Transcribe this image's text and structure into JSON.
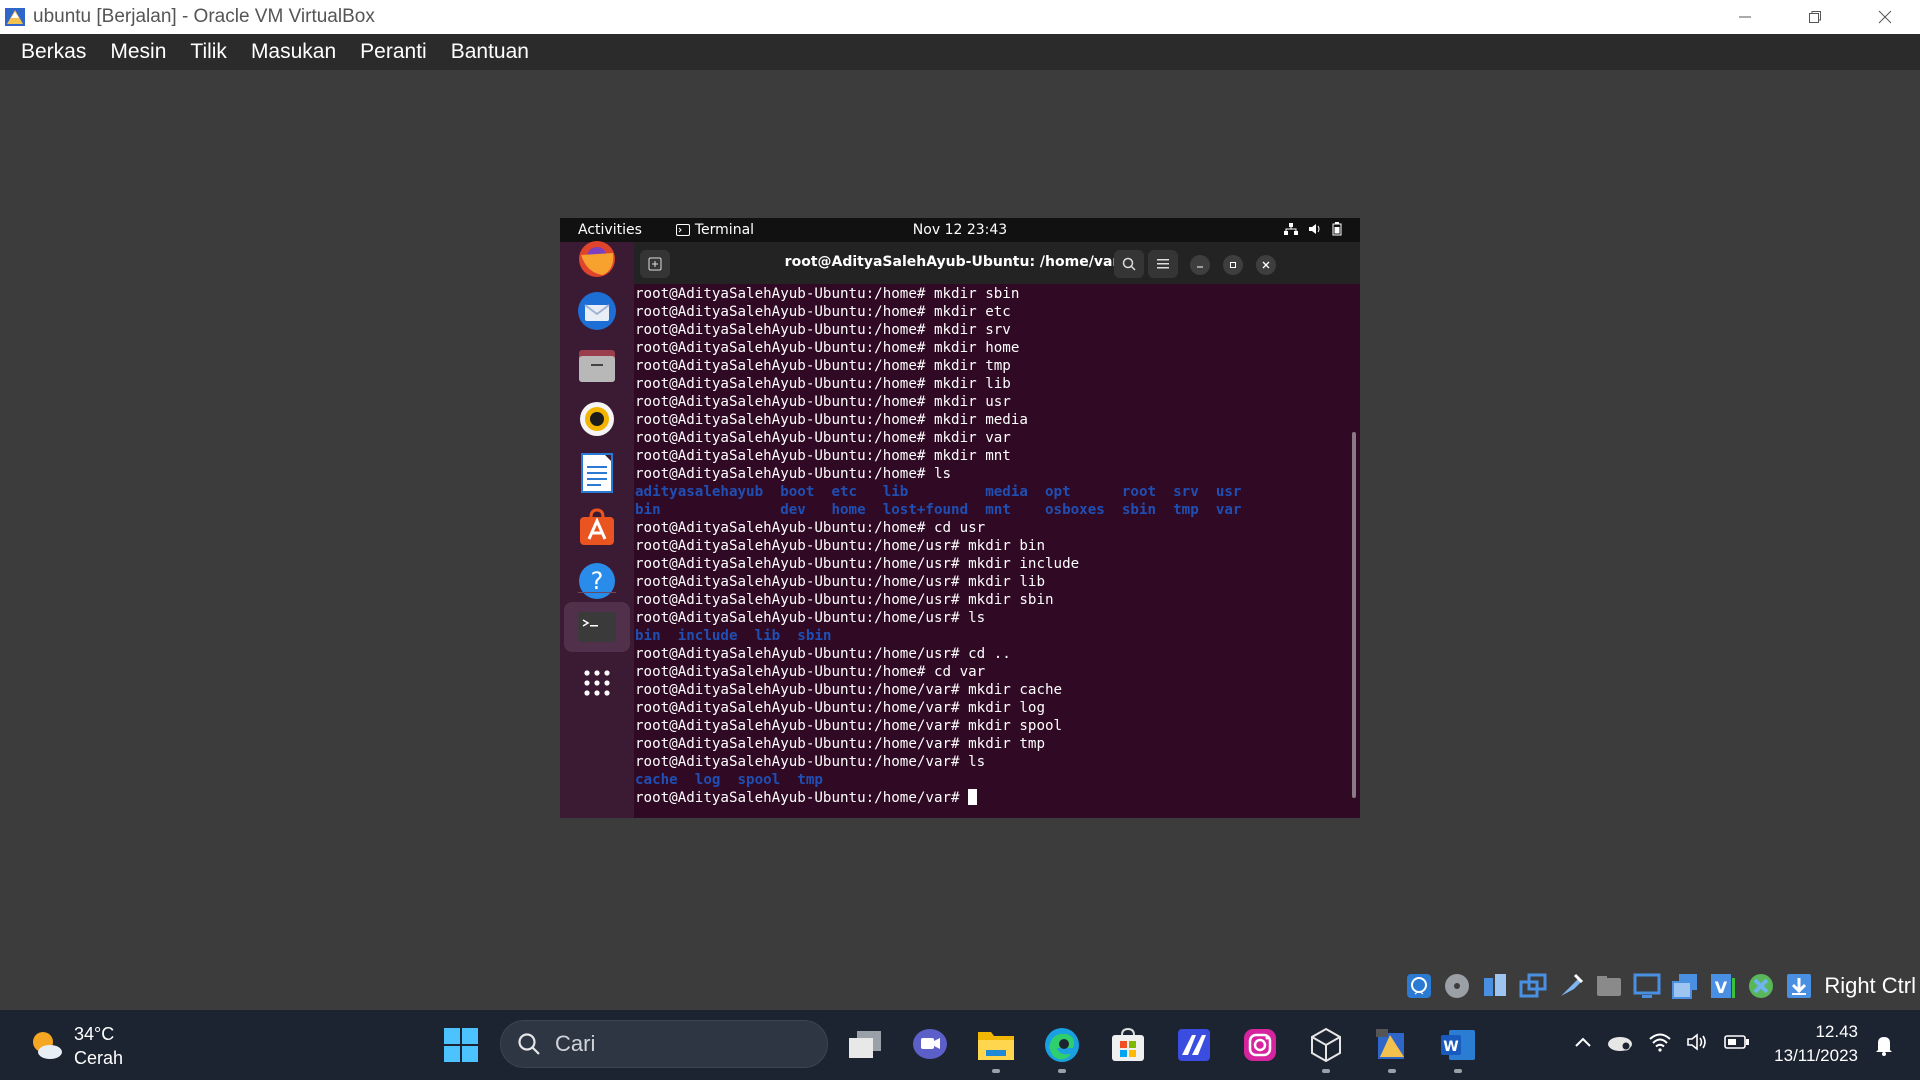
{
  "window": {
    "title": "ubuntu [Berjalan] - Oracle VM VirtualBox",
    "menu": [
      "Berkas",
      "Mesin",
      "Tilik",
      "Masukan",
      "Peranti",
      "Bantuan"
    ]
  },
  "guest": {
    "topbar": {
      "activities": "Activities",
      "app": "Terminal",
      "clock": "Nov 12  23:43"
    },
    "dock": [
      "firefox",
      "thunderbird",
      "files",
      "rhythmbox",
      "libreoffice-writer",
      "ubuntu-software",
      "help",
      "terminal",
      "show-apps"
    ],
    "terminal": {
      "title": "root@AdityaSalehAyub-Ubuntu: /home/var",
      "lines": [
        {
          "text": "root@AdityaSalehAyub-Ubuntu:/home# mkdir sbin",
          "type": "cmd"
        },
        {
          "text": "root@AdityaSalehAyub-Ubuntu:/home# mkdir etc",
          "type": "cmd"
        },
        {
          "text": "root@AdityaSalehAyub-Ubuntu:/home# mkdir srv",
          "type": "cmd"
        },
        {
          "text": "root@AdityaSalehAyub-Ubuntu:/home# mkdir home",
          "type": "cmd"
        },
        {
          "text": "root@AdityaSalehAyub-Ubuntu:/home# mkdir tmp",
          "type": "cmd"
        },
        {
          "text": "root@AdityaSalehAyub-Ubuntu:/home# mkdir lib",
          "type": "cmd"
        },
        {
          "text": "root@AdityaSalehAyub-Ubuntu:/home# mkdir usr",
          "type": "cmd"
        },
        {
          "text": "root@AdityaSalehAyub-Ubuntu:/home# mkdir media",
          "type": "cmd"
        },
        {
          "text": "root@AdityaSalehAyub-Ubuntu:/home# mkdir var",
          "type": "cmd"
        },
        {
          "text": "root@AdityaSalehAyub-Ubuntu:/home# mkdir mnt",
          "type": "cmd"
        },
        {
          "text": "root@AdityaSalehAyub-Ubuntu:/home# ls",
          "type": "cmd"
        },
        {
          "text": "adityasalehayub  boot  etc   lib         media  opt      root  srv  usr",
          "type": "dir"
        },
        {
          "text": "bin              dev   home  lost+found  mnt    osboxes  sbin  tmp  var",
          "type": "dir"
        },
        {
          "text": "root@AdityaSalehAyub-Ubuntu:/home# cd usr",
          "type": "cmd"
        },
        {
          "text": "root@AdityaSalehAyub-Ubuntu:/home/usr# mkdir bin",
          "type": "cmd"
        },
        {
          "text": "root@AdityaSalehAyub-Ubuntu:/home/usr# mkdir include",
          "type": "cmd"
        },
        {
          "text": "root@AdityaSalehAyub-Ubuntu:/home/usr# mkdir lib",
          "type": "cmd"
        },
        {
          "text": "root@AdityaSalehAyub-Ubuntu:/home/usr# mkdir sbin",
          "type": "cmd"
        },
        {
          "text": "root@AdityaSalehAyub-Ubuntu:/home/usr# ls",
          "type": "cmd"
        },
        {
          "text": "bin  include  lib  sbin",
          "type": "dir"
        },
        {
          "text": "root@AdityaSalehAyub-Ubuntu:/home/usr# cd ..",
          "type": "cmd"
        },
        {
          "text": "root@AdityaSalehAyub-Ubuntu:/home# cd var",
          "type": "cmd"
        },
        {
          "text": "root@AdityaSalehAyub-Ubuntu:/home/var# mkdir cache",
          "type": "cmd"
        },
        {
          "text": "root@AdityaSalehAyub-Ubuntu:/home/var# mkdir log",
          "type": "cmd"
        },
        {
          "text": "root@AdityaSalehAyub-Ubuntu:/home/var# mkdir spool",
          "type": "cmd"
        },
        {
          "text": "root@AdityaSalehAyub-Ubuntu:/home/var# mkdir tmp",
          "type": "cmd"
        },
        {
          "text": "root@AdityaSalehAyub-Ubuntu:/home/var# ls",
          "type": "cmd"
        },
        {
          "text": "cache  log  spool  tmp",
          "type": "dir"
        }
      ],
      "prompt": "root@AdityaSalehAyub-Ubuntu:/home/var# "
    }
  },
  "vb_status": {
    "host_key": "Right Ctrl"
  },
  "taskbar": {
    "weather": {
      "temp": "34°C",
      "condition": "Cerah"
    },
    "search_placeholder": "Cari",
    "time": "12.43",
    "date": "13/11/2023"
  },
  "colors": {
    "terminal_bg": "#300a24",
    "dir_blue": "#1f4fb4",
    "taskbar_bg": "#1c2431"
  }
}
